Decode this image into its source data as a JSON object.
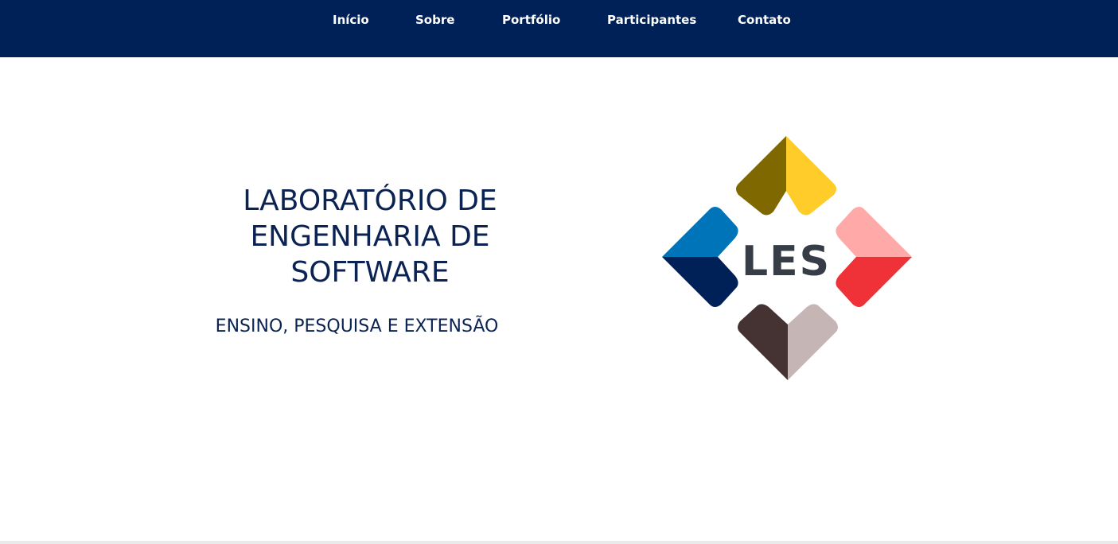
{
  "nav": {
    "items": [
      {
        "label": "Início"
      },
      {
        "label": "Sobre"
      },
      {
        "label": "Portfólio"
      },
      {
        "label": "Participantes"
      },
      {
        "label": "Contato"
      }
    ],
    "background": "#002157",
    "text_color": "#ffffff"
  },
  "hero": {
    "title": "LABORATÓRIO DE ENGENHARIA DE SOFTWARE",
    "subtitle": "ENSINO, PESQUISA E EXTENSÃO",
    "text_color": "#0b2353"
  },
  "logo": {
    "text": "LES",
    "colors": {
      "top_left": "#7f6800",
      "top_right": "#ffcc2a",
      "left_top": "#0074b8",
      "left_bottom": "#002157",
      "right_top": "#ffa9a9",
      "right_bottom": "#ef3237",
      "bottom_left": "#453333",
      "bottom_right": "#c6b5b5",
      "text": "#373d47"
    }
  }
}
